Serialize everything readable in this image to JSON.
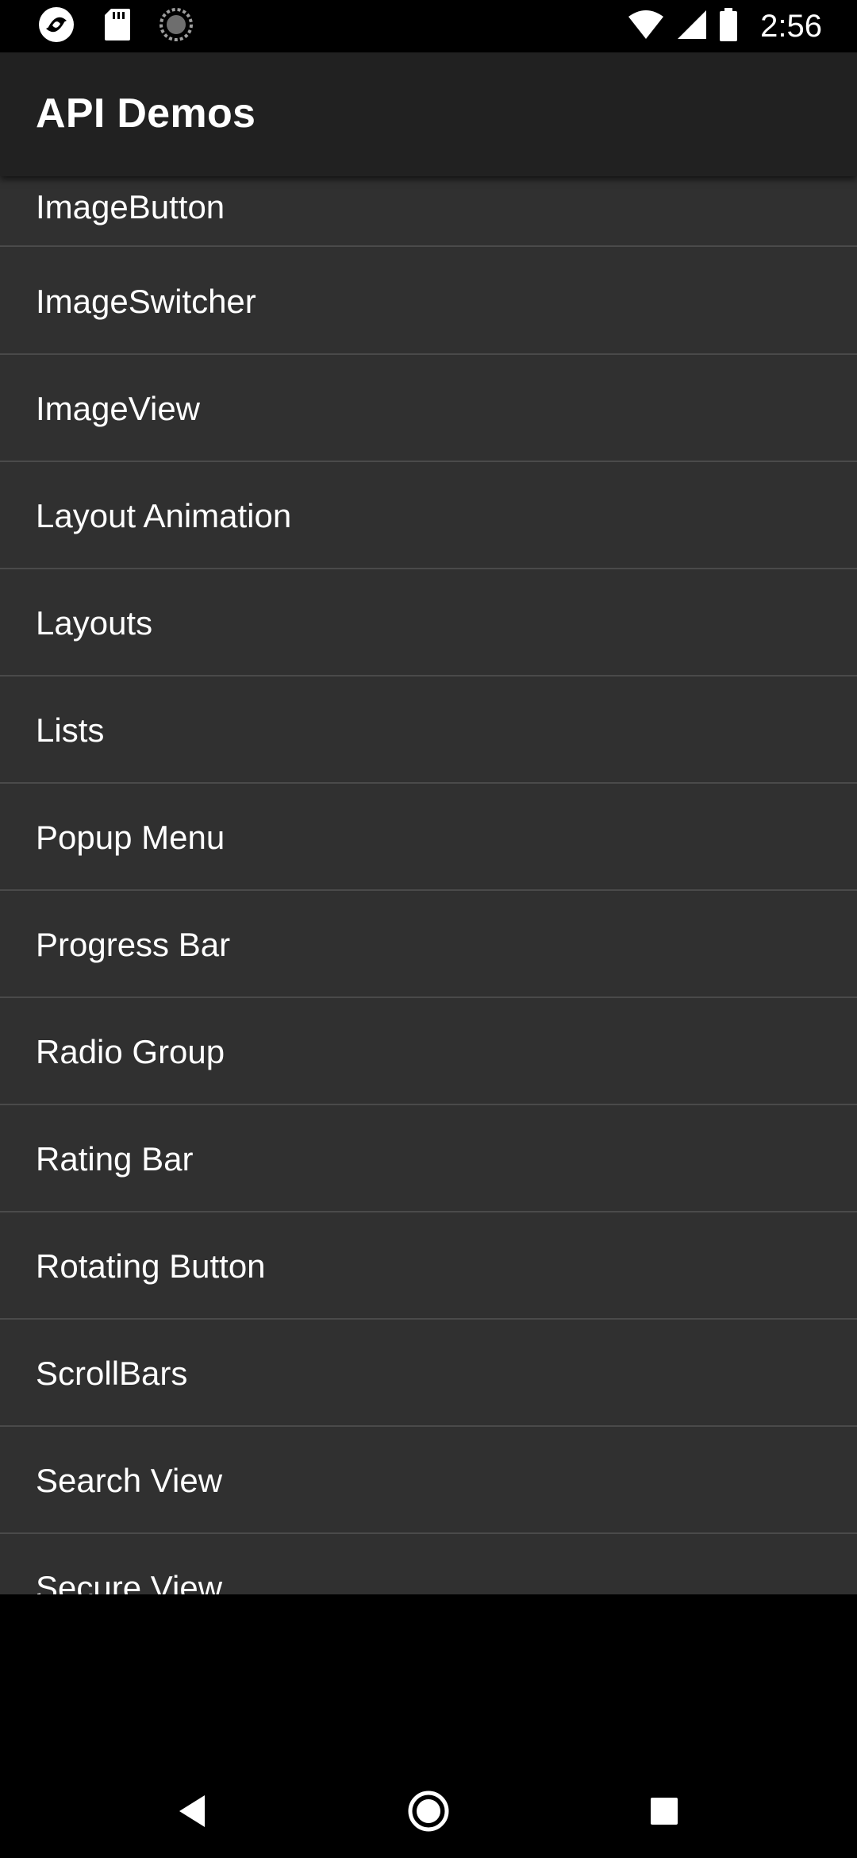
{
  "status_bar": {
    "time": "2:56",
    "icons_left": [
      "app-notification-icon",
      "sd-card-icon",
      "sync-icon"
    ],
    "icons_right": [
      "wifi-icon",
      "signal-icon",
      "battery-icon"
    ]
  },
  "app_bar": {
    "title": "API Demos"
  },
  "list": {
    "items": [
      {
        "label": "ImageButton"
      },
      {
        "label": "ImageSwitcher"
      },
      {
        "label": "ImageView"
      },
      {
        "label": "Layout Animation"
      },
      {
        "label": "Layouts"
      },
      {
        "label": "Lists"
      },
      {
        "label": "Popup Menu"
      },
      {
        "label": "Progress Bar"
      },
      {
        "label": "Radio Group"
      },
      {
        "label": "Rating Bar"
      },
      {
        "label": "Rotating Button"
      },
      {
        "label": "ScrollBars"
      },
      {
        "label": "Search View"
      },
      {
        "label": "Secure View"
      }
    ]
  },
  "nav_bar": {
    "buttons": [
      "back-icon",
      "home-icon",
      "recents-icon"
    ]
  },
  "colors": {
    "list_background": "#303030",
    "app_bar": "#212121",
    "divider": "#4a4a4a",
    "text": "#ffffff"
  }
}
